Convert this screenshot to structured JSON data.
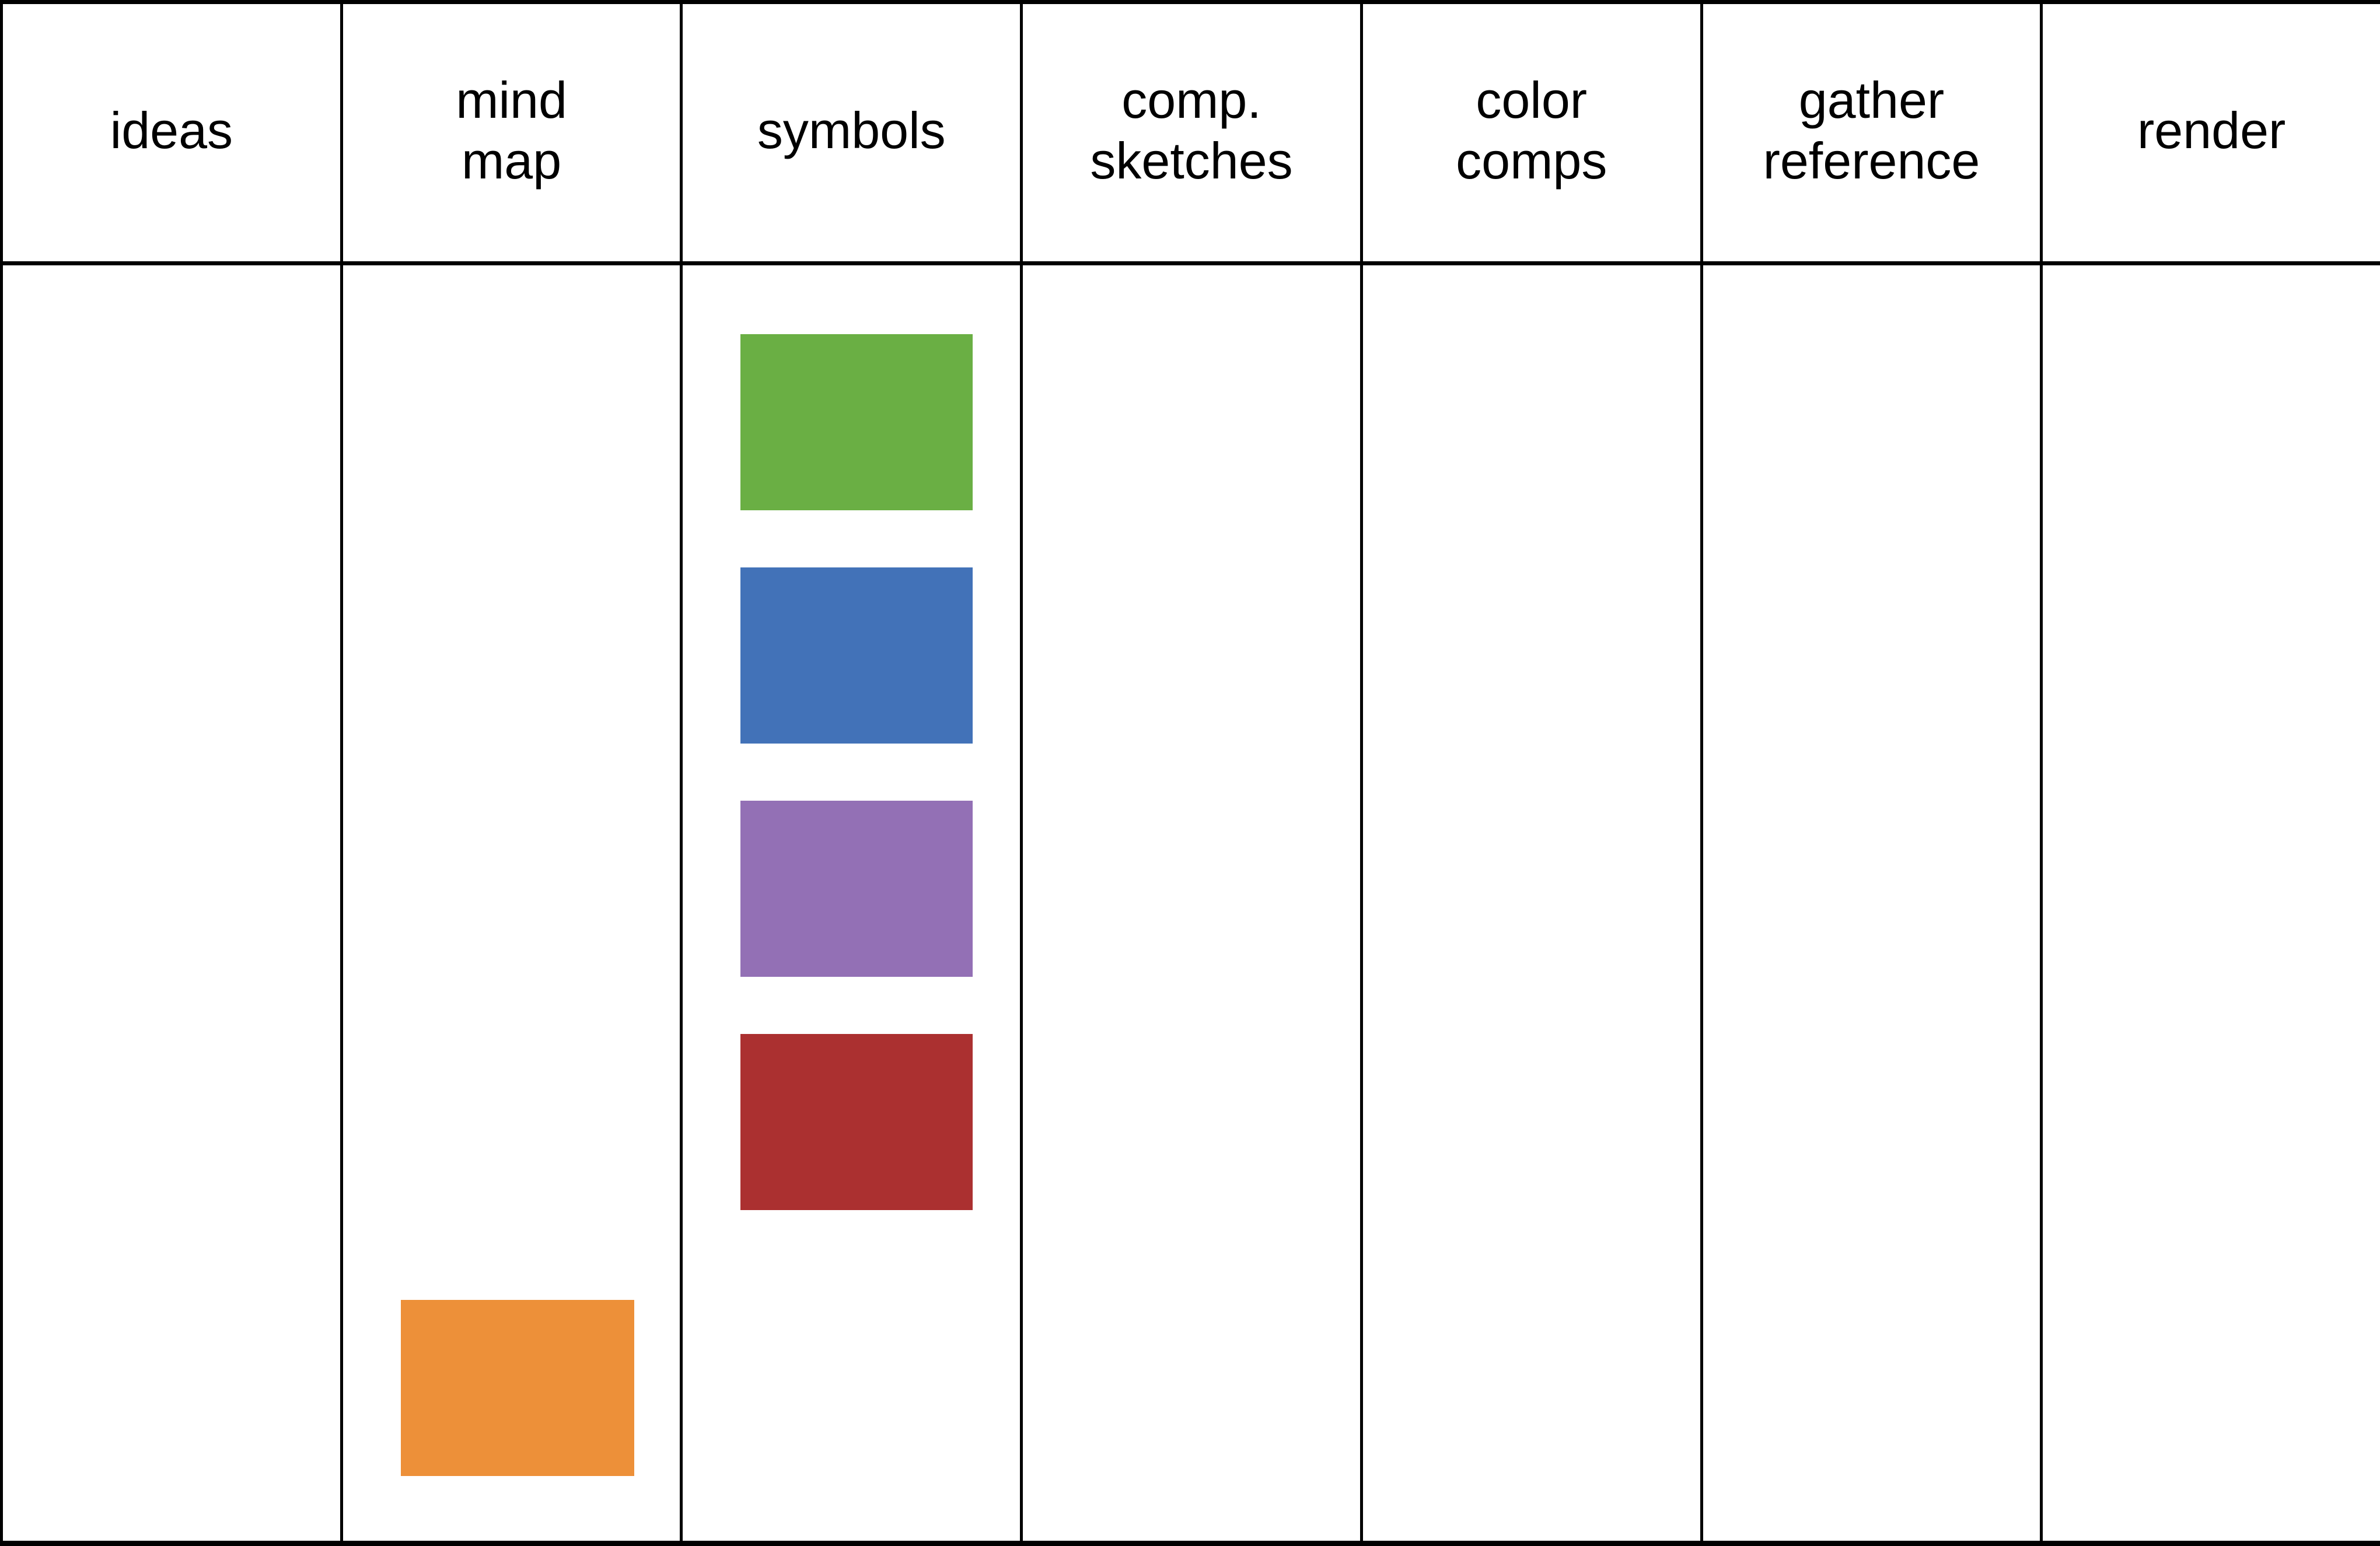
{
  "board": {
    "type": "kanban-board",
    "background_color": "#ffffff",
    "border_color": "#000000",
    "column_count": 7,
    "card_count": 5
  },
  "columns": [
    {
      "id": "ideas",
      "title_lines": [
        "ideas"
      ],
      "cards": []
    },
    {
      "id": "mind-map",
      "title_lines": [
        "mind",
        "map"
      ],
      "cards": [
        {
          "id": "mind-map-card-1",
          "color": "#ED9039",
          "label": ""
        }
      ]
    },
    {
      "id": "symbols",
      "title_lines": [
        "symbols"
      ],
      "cards": [
        {
          "id": "symbols-card-1",
          "color": "#6AAF44",
          "label": ""
        },
        {
          "id": "symbols-card-2",
          "color": "#4272B8",
          "label": ""
        },
        {
          "id": "symbols-card-3",
          "color": "#9370B5",
          "label": ""
        },
        {
          "id": "symbols-card-4",
          "color": "#AB3030",
          "label": ""
        }
      ]
    },
    {
      "id": "comp-sketches",
      "title_lines": [
        "comp.",
        "sketches"
      ],
      "cards": []
    },
    {
      "id": "color-comps",
      "title_lines": [
        "color",
        "comps"
      ],
      "cards": []
    },
    {
      "id": "gather-reference",
      "title_lines": [
        "gather",
        "reference"
      ],
      "cards": []
    },
    {
      "id": "render",
      "title_lines": [
        "render"
      ],
      "cards": []
    }
  ],
  "palette": {
    "green": "#6AAF44",
    "blue": "#4272B8",
    "purple": "#9370B5",
    "red": "#AB3030",
    "orange": "#ED9039"
  }
}
